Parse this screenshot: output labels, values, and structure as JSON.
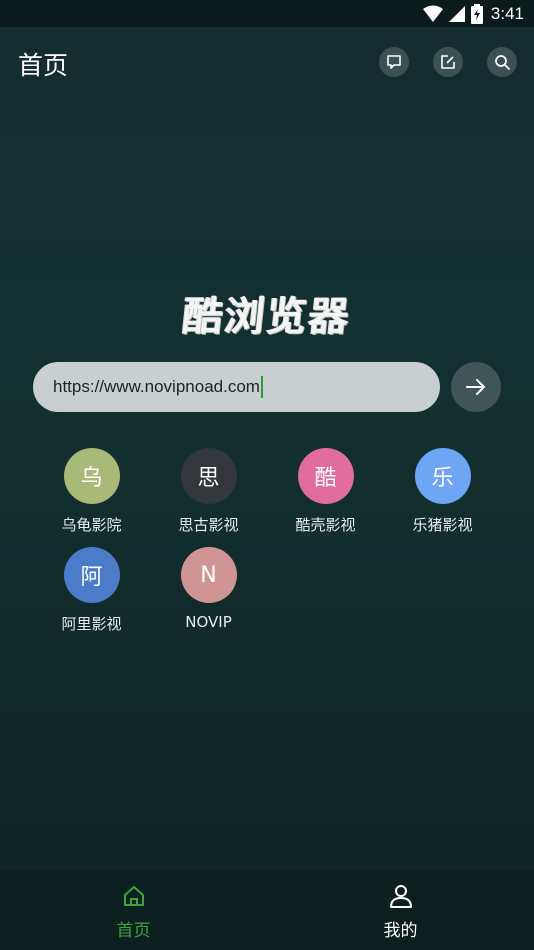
{
  "status_bar": {
    "time": "3:41",
    "icons": [
      "wifi-icon",
      "cell-signal-icon",
      "battery-icon"
    ]
  },
  "header": {
    "title": "首页",
    "actions": [
      "message-icon",
      "edit-icon",
      "search-icon"
    ]
  },
  "logo_text": "酷浏览器",
  "search": {
    "value": "https://www.novipnoad.com"
  },
  "shortcuts": [
    {
      "initial": "乌",
      "label": "乌龟影院",
      "color": "#a9b978"
    },
    {
      "initial": "思",
      "label": "思古影视",
      "color": "#33363a"
    },
    {
      "initial": "酷",
      "label": "酷壳影视",
      "color": "#e26c9c"
    },
    {
      "initial": "乐",
      "label": "乐猪影视",
      "color": "#6ea6f5"
    },
    {
      "initial": "阿",
      "label": "阿里影视",
      "color": "#4a7cca"
    },
    {
      "initial": "N",
      "label": "NOVIP",
      "color": "#d09593"
    }
  ],
  "bottom_nav": {
    "home_label": "首页",
    "mine_label": "我的",
    "active_color": "#3da33f",
    "inactive_color": "#ffffff"
  }
}
